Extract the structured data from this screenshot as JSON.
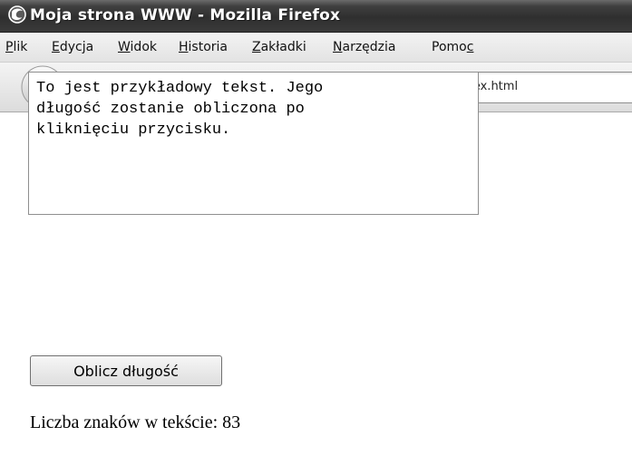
{
  "window": {
    "title": "Moja strona WWW - Mozilla Firefox",
    "app_icon": "firefox-icon"
  },
  "menu": {
    "items": [
      {
        "label_underlined": "P",
        "label_rest": "lik"
      },
      {
        "label_underlined": "E",
        "label_rest": "dycja"
      },
      {
        "label_underlined": "W",
        "label_rest": "idok"
      },
      {
        "label_underlined": "H",
        "label_rest": "istoria"
      },
      {
        "label_underlined": "Z",
        "label_rest": "akładki"
      },
      {
        "label_underlined": "N",
        "label_rest": "arzędzia"
      },
      {
        "label_prefix": "Pomo",
        "label_underlined": "c"
      }
    ]
  },
  "toolbar": {
    "back_icon": "back-arrow-icon",
    "forward_icon": "forward-arrow-icon",
    "history_icon": "chevron-down-icon",
    "reload_icon": "reload-icon",
    "stop_icon": "stop-icon",
    "home_icon": "home-icon",
    "address": {
      "site_icon": "page-icon",
      "url": "file:///C:/!/index.html"
    }
  },
  "page": {
    "textarea_value": "To jest przykładowy tekst. Jego\ndługość zostanie obliczona po\nkliknięciu przycisku.",
    "button_label": "Oblicz długość",
    "result_text": "Liczba znaków w tekście: 83"
  },
  "colors": {
    "titlebar": "#2f2f2f",
    "menubar": "#e9e9e9",
    "toolbar": "#e6e6e6",
    "content_bg": "#ffffff"
  }
}
